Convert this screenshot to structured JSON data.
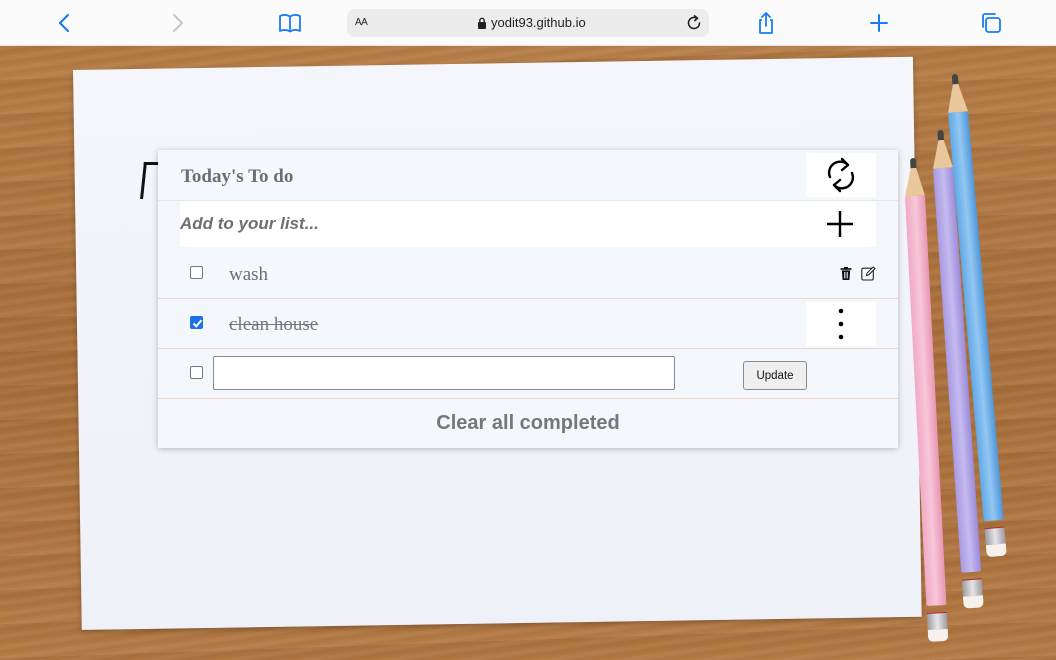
{
  "browser": {
    "aa_label": "AA",
    "url": "yodit93.github.io",
    "accent_color": "#1a7cf0",
    "icons": [
      "back-icon",
      "forward-icon",
      "bookmarks-icon",
      "lock-icon",
      "reload-icon",
      "share-icon",
      "new-tab-icon",
      "tabs-icon"
    ]
  },
  "todo": {
    "title": "Today's To do",
    "add_placeholder": "Add to your list...",
    "items": [
      {
        "text": "wash",
        "completed": false
      },
      {
        "text": "clean house",
        "completed": true
      }
    ],
    "edit_row": {
      "value": "",
      "completed": false,
      "button_label": "Update"
    },
    "clear_label": "Clear all completed",
    "checkbox_color": "#1b73e8",
    "text_color": "#6e6e6e",
    "divider_color": "#f0d6c8"
  }
}
